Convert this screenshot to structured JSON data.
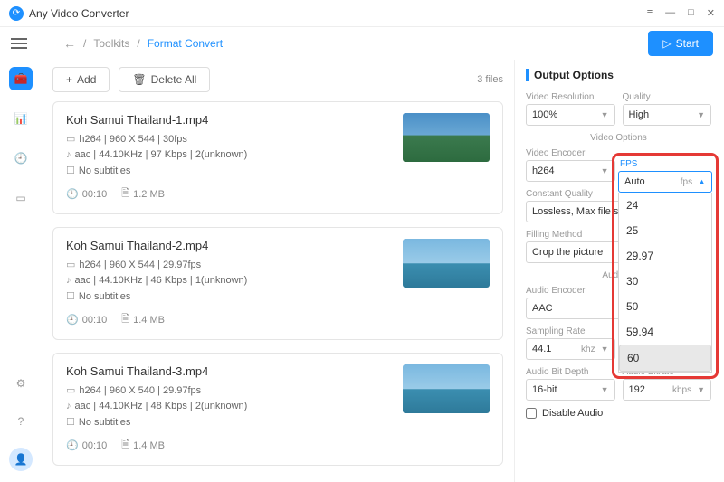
{
  "app": {
    "title": "Any Video Converter"
  },
  "win": {
    "menu": "≡",
    "min": "—",
    "max": "□",
    "close": "✕"
  },
  "header": {
    "back": "←",
    "sep": "/",
    "crumb1": "Toolkits",
    "crumb2": "Format Convert",
    "start": "Start"
  },
  "toolbar": {
    "add": "Add",
    "delete_all": "Delete All",
    "filecount": "3 files"
  },
  "files": [
    {
      "name": "Koh Samui Thailand-1.mp4",
      "v": "h264 | 960 X 544 | 30fps",
      "a": "aac | 44.10KHz | 97 Kbps | 2(unknown)",
      "s": "No subtitles",
      "dur": "00:10",
      "size": "1.2 MB"
    },
    {
      "name": "Koh Samui Thailand-2.mp4",
      "v": "h264 | 960 X 544 | 29.97fps",
      "a": "aac | 44.10KHz | 46 Kbps | 1(unknown)",
      "s": "No subtitles",
      "dur": "00:10",
      "size": "1.4 MB"
    },
    {
      "name": "Koh Samui Thailand-3.mp4",
      "v": "h264 | 960 X 540 | 29.97fps",
      "a": "aac | 44.10KHz | 48 Kbps | 2(unknown)",
      "s": "No subtitles",
      "dur": "00:10",
      "size": "1.4 MB"
    }
  ],
  "output": {
    "title": "Output Options",
    "res_label": "Video Resolution",
    "res": "100%",
    "quality_label": "Quality",
    "quality": "High",
    "video_section": "Video Options",
    "enc_label": "Video Encoder",
    "enc": "h264",
    "fps_label": "FPS",
    "fps": "Auto",
    "fps_unit": "fps",
    "cq_label": "Constant Quality",
    "cq": "Lossless, Max file size",
    "fill_label": "Filling Method",
    "fill": "Crop the picture",
    "audio_section": "Audio Options",
    "aenc_label": "Audio Encoder",
    "aenc": "AAC",
    "sr_label": "Sampling Rate",
    "sr": "44.1",
    "sr_unit": "khz",
    "abd_label": "Audio Bit Depth",
    "abd": "16-bit",
    "abr_label": "Audio Bitrate",
    "abr": "192",
    "abr_unit": "kbps",
    "disable": "Disable Audio",
    "fps_options": [
      "24",
      "25",
      "29.97",
      "30",
      "50",
      "59.94",
      "60"
    ]
  }
}
